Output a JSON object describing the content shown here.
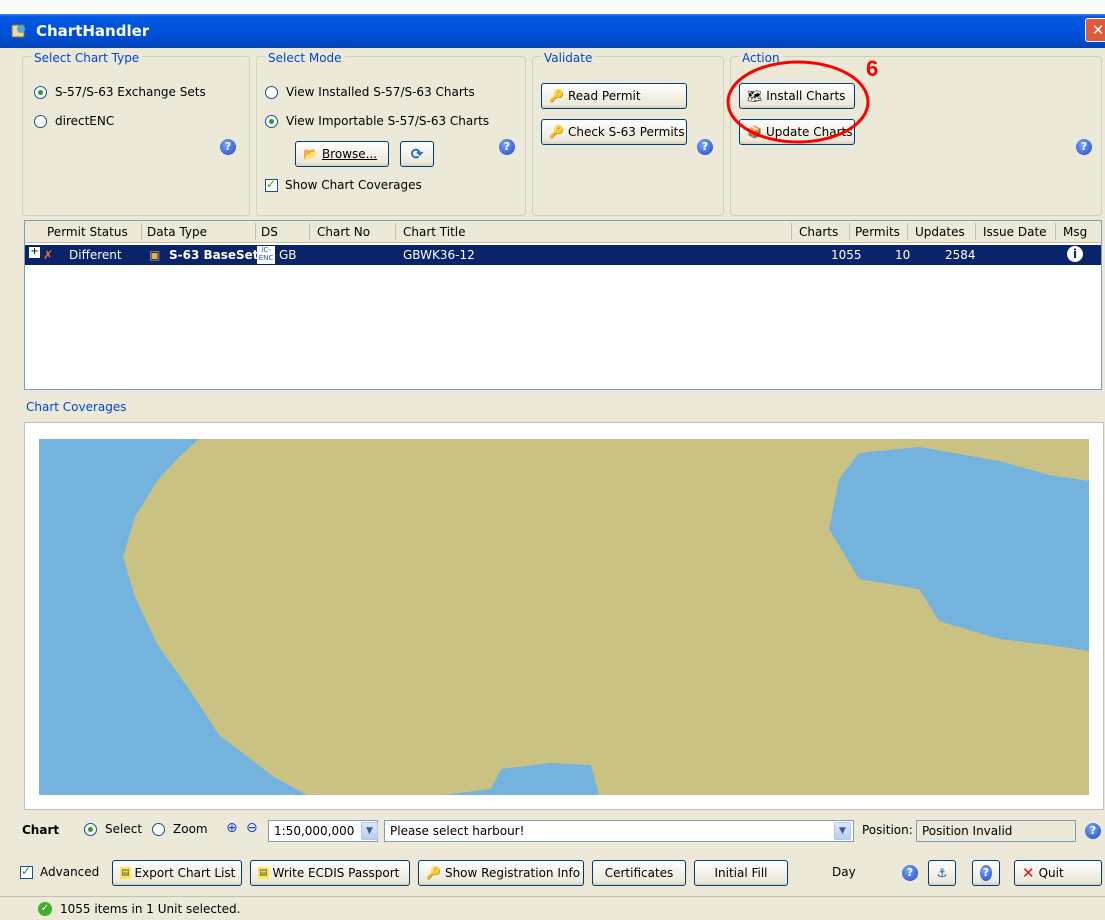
{
  "window": {
    "title": "ChartHandler",
    "close_glyph": "✕"
  },
  "select_chart_type": {
    "legend": "Select Chart Type",
    "options": [
      "S-57/S-63 Exchange Sets",
      "directENC"
    ],
    "selected": 0
  },
  "select_mode": {
    "legend": "Select Mode",
    "options": [
      "View Installed S-57/S-63 Charts",
      "View Importable S-57/S-63 Charts"
    ],
    "selected": 1,
    "browse_label": "Browse...",
    "show_coverages_label": "Show Chart Coverages",
    "show_coverages_checked": true
  },
  "validate": {
    "legend": "Validate",
    "read_permit": "Read Permit",
    "check_permits": "Check S-63 Permits"
  },
  "action": {
    "legend": "Action",
    "install_charts": "Install Charts",
    "update_charts": "Update Charts",
    "annotation_number": "6",
    "annotation_color": "#ff0000"
  },
  "table": {
    "columns": [
      "Permit Status",
      "Data Type",
      "DS",
      "Chart No",
      "Chart Title",
      "Charts",
      "Permits",
      "Updates",
      "Issue Date",
      "Msg"
    ],
    "rows": [
      {
        "permit_status": "Different",
        "data_type": "S-63 BaseSet",
        "ds_badge": "IC-ENC",
        "ds": "GB",
        "chart_no": "",
        "chart_title": "GBWK36-12",
        "charts": "1055",
        "permits": "10",
        "updates": "2584",
        "issue_date": "",
        "msg_icon": "info-icon"
      }
    ]
  },
  "coverages": {
    "label": "Chart Coverages",
    "land_color": "#c9c283",
    "sea_color": "#74b3de"
  },
  "chart_bar": {
    "label": "Chart",
    "select_label": "Select",
    "zoom_label": "Zoom",
    "mode_selected": "Select",
    "scale": "1:50,000,000",
    "harbour_placeholder": "Please select harbour!",
    "position_label": "Position:",
    "position_value": "Position Invalid"
  },
  "bottom_bar": {
    "advanced_label": "Advanced",
    "advanced_checked": true,
    "export_chart_list": "Export Chart List",
    "write_passport": "Write ECDIS Passport",
    "show_registration": "Show Registration Info",
    "certificates": "Certificates",
    "initial_fill": "Initial Fill",
    "day_label": "Day",
    "quit": "Quit"
  },
  "status": {
    "text": "1055 items in 1 Unit  selected."
  }
}
